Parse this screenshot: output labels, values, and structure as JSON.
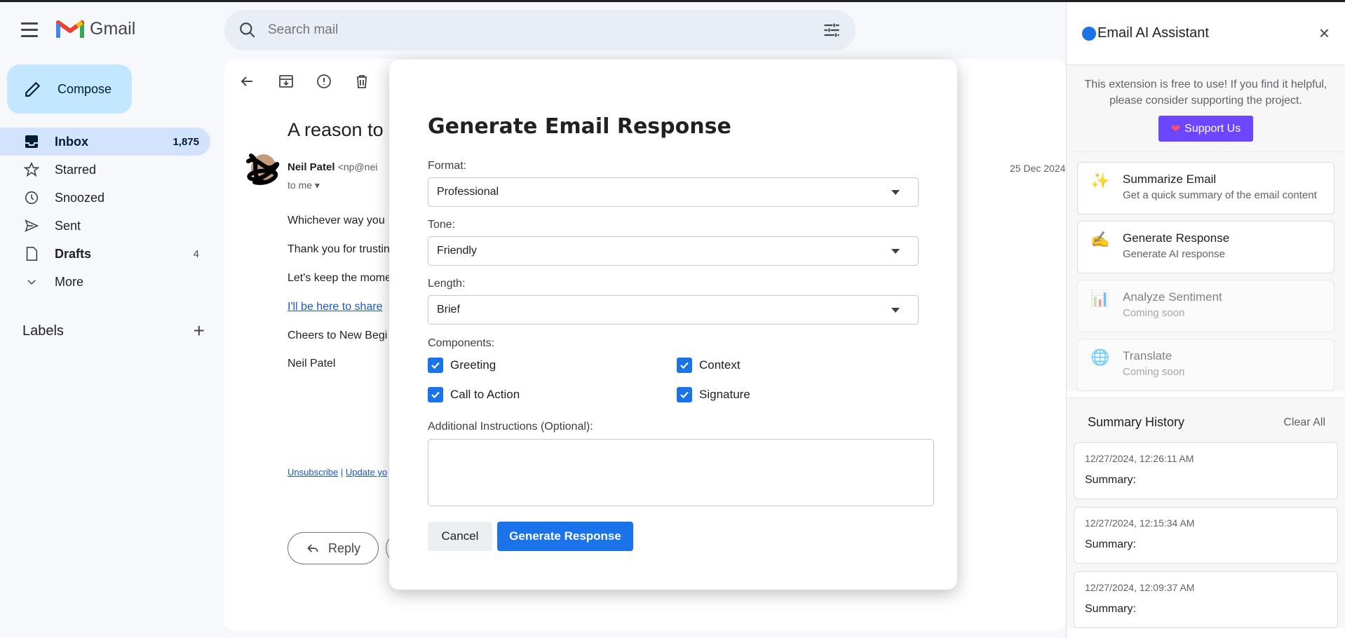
{
  "app": {
    "name": "Gmail"
  },
  "search": {
    "placeholder": "Search mail"
  },
  "compose": {
    "label": "Compose"
  },
  "nav": [
    {
      "label": "Inbox",
      "count": "1,875",
      "icon": "inbox-icon",
      "active": true
    },
    {
      "label": "Starred",
      "count": "",
      "icon": "star-icon"
    },
    {
      "label": "Snoozed",
      "count": "",
      "icon": "clock-icon"
    },
    {
      "label": "Sent",
      "count": "",
      "icon": "send-icon"
    },
    {
      "label": "Drafts",
      "count": "4",
      "icon": "draft-icon",
      "bold": true
    },
    {
      "label": "More",
      "count": "",
      "icon": "chevron-down-icon"
    }
  ],
  "labels": {
    "title": "Labels"
  },
  "email": {
    "subject": "A reason to",
    "sender_name": "Neil Patel",
    "sender_addr": "<np@nei",
    "to": "to me",
    "date": "25 Dec 2024",
    "lines": [
      "Whichever way you",
      "Thank you for trustin",
      "Let's keep the mome",
      "I'll be here to share",
      "Cheers to New Begi",
      "Neil Patel"
    ],
    "unsubscribe": "Unsubscribe",
    "update": "Update yo",
    "reply": "Reply"
  },
  "modal": {
    "title": "Generate Email Response",
    "format_label": "Format:",
    "format_value": "Professional",
    "tone_label": "Tone:",
    "tone_value": "Friendly",
    "length_label": "Length:",
    "length_value": "Brief",
    "components_label": "Components:",
    "components": [
      "Greeting",
      "Context",
      "Call to Action",
      "Signature"
    ],
    "instructions_label": "Additional Instructions (Optional):",
    "cancel": "Cancel",
    "generate": "Generate Response"
  },
  "panel": {
    "title": "Email AI Assistant",
    "support_text": "This extension is free to use! If you find it helpful, please consider supporting the project.",
    "support_btn": "Support Us",
    "cards": [
      {
        "title": "Summarize Email",
        "sub": "Get a quick summary of the email content",
        "icon": "✨"
      },
      {
        "title": "Generate Response",
        "sub": "Generate AI response",
        "icon": "✍️"
      },
      {
        "title": "Analyze Sentiment",
        "sub": "Coming soon",
        "icon": "📊"
      },
      {
        "title": "Translate",
        "sub": "Coming soon",
        "icon": "🌐"
      }
    ],
    "history_title": "Summary History",
    "clear_all": "Clear All",
    "history": [
      {
        "date": "12/27/2024, 12:26:11 AM",
        "summary": "Summary:"
      },
      {
        "date": "12/27/2024, 12:15:34 AM",
        "summary": "Summary:"
      },
      {
        "date": "12/27/2024, 12:09:37 AM",
        "summary": "Summary:"
      }
    ]
  },
  "colors": {
    "accent": "#1a73e8",
    "support": "#6c47ff",
    "nav_active": "#d3e3fd",
    "compose": "#c2e7ff"
  }
}
